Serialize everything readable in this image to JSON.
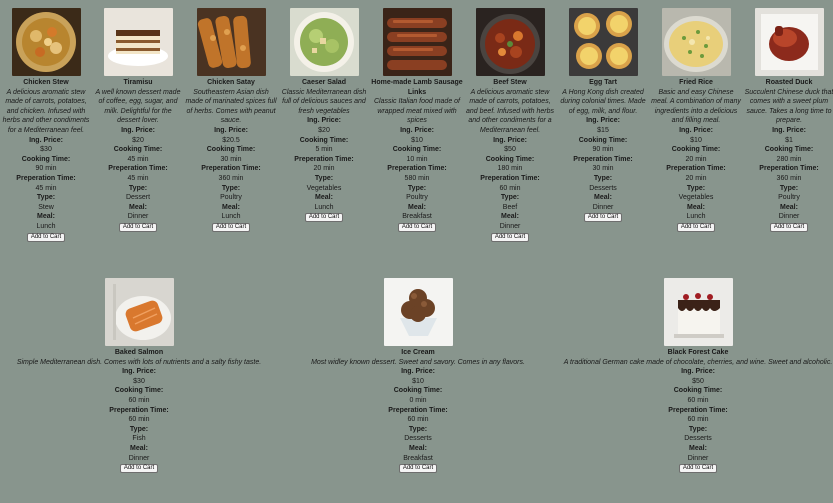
{
  "labels": {
    "price": "Ing. Price:",
    "cooking": "Cooking Time:",
    "prep": "Preperation Time:",
    "type": "Type:",
    "meal": "Meal:",
    "add_to_cart": "Add to Cart"
  },
  "row1": [
    {
      "name": "Chicken Stew",
      "desc": "A delicious aromatic stew made of carrots, potatoes, and chicken. Infused with herbs and other condiments for a Mediterranean feel.",
      "price": "$30",
      "cooking": "90 min",
      "prep": "45 min",
      "type": "Stew",
      "meal": "Lunch",
      "image": "chicken-stew-image"
    },
    {
      "name": "Tiramisu",
      "desc": "A well known dessert made of coffee, egg, sugar, and milk. Delightful for the dessert lover.",
      "price": "$20",
      "cooking": "45 min",
      "prep": "45 min",
      "type": "Dessert",
      "meal": "Dinner",
      "image": "tiramisu-image"
    },
    {
      "name": "Chicken Satay",
      "desc": "Southeastern Asian dish made of marinated spices full of herbs. Comes with peanut sauce.",
      "price": "$20.5",
      "cooking": "30 min",
      "prep": "360 min",
      "type": "Poultry",
      "meal": "Lunch",
      "image": "chicken-satay-image"
    },
    {
      "name": "Caeser Salad",
      "desc": "Classic Mediterranean dish full of delicious sauces and fresh vegetables",
      "price": "$20",
      "cooking": "5 min",
      "prep": "20 min",
      "type": "Vegetables",
      "meal": "Lunch",
      "image": "caeser-salad-image"
    },
    {
      "name": "Home-made Lamb Sausage Links",
      "desc": "Classic Italian food made of wrapped meat mixed with spices",
      "price": "$10",
      "cooking": "10 min",
      "prep": "580 min",
      "type": "Poultry",
      "meal": "Breakfast",
      "image": "lamb-sausage-image"
    },
    {
      "name": "Beef Stew",
      "desc": "A delicious aromatic stew made of carrots, potatoes, and beef. Infused with herbs and other condiments for a Mediterranean feel.",
      "price": "$50",
      "cooking": "180 min",
      "prep": "60 min",
      "type": "Beef",
      "meal": "Dinner",
      "image": "beef-stew-image"
    },
    {
      "name": "Egg Tart",
      "desc": "A Hong Kong dish created during colonial times. Made of egg, milk, and flour.",
      "price": "$15",
      "cooking": "90 min",
      "prep": "30 min",
      "type": "Desserts",
      "meal": "Dinner",
      "image": "egg-tart-image"
    },
    {
      "name": "Fried Rice",
      "desc": "Basic and easy Chinese meal. A combination of many ingredients into a delicious and filling meal.",
      "price": "$10",
      "cooking": "20 min",
      "prep": "20 min",
      "type": "Vegetables",
      "meal": "Lunch",
      "image": "fried-rice-image"
    },
    {
      "name": "Roasted Duck",
      "desc": "Succulent Chinese duck that comes with a sweet plum sauce. Takes a long time to prepare.",
      "price": "$1",
      "cooking": "280 min",
      "prep": "360 min",
      "type": "Poultry",
      "meal": "Dinner",
      "image": "roasted-duck-image"
    }
  ],
  "row2": [
    {
      "name": "Baked Salmon",
      "desc": "Simple Mediterranean dish. Comes with lots of nutrients and a salty fishy taste.",
      "price": "$30",
      "cooking": "60 min",
      "prep": "60 min",
      "type": "Fish",
      "meal": "Dinner",
      "image": "baked-salmon-image"
    },
    {
      "name": "Ice Cream",
      "desc": "Most widley known dessert. Sweet and savory. Comes in any flavors.",
      "price": "$10",
      "cooking": "0 min",
      "prep": "60 min",
      "type": "Desserts",
      "meal": "Breakfast",
      "image": "ice-cream-image"
    },
    {
      "name": "Black Forest Cake",
      "desc": "A traditional German cake made of chocolate, cherries, and wine. Sweet and alcoholic.",
      "price": "$50",
      "cooking": "60 min",
      "prep": "60 min",
      "type": "Desserts",
      "meal": "Dinner",
      "image": "black-forest-cake-image"
    }
  ]
}
